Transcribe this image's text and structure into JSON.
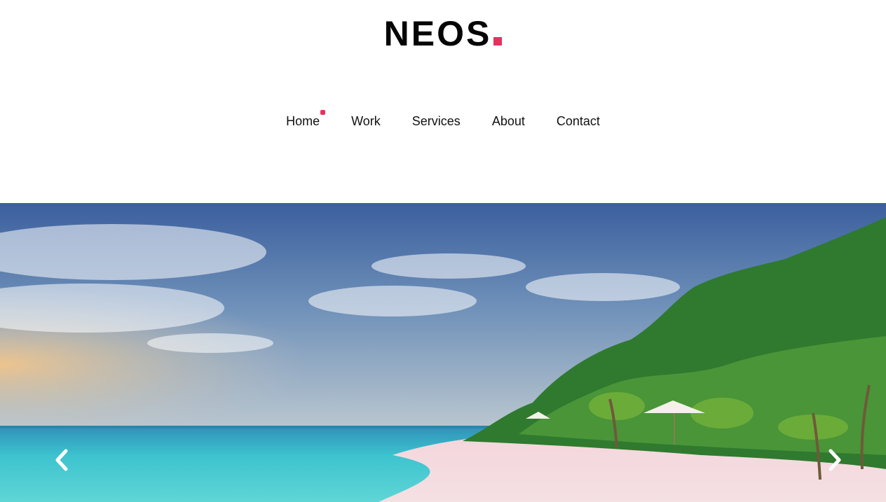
{
  "brand": {
    "name": "NEOS",
    "accent": "#e8305f"
  },
  "nav": {
    "active_index": 0,
    "items": [
      {
        "label": "Home"
      },
      {
        "label": "Work"
      },
      {
        "label": "Services"
      },
      {
        "label": "About"
      },
      {
        "label": "Contact"
      }
    ]
  },
  "slider": {
    "prev_icon": "chevron-left-icon",
    "next_icon": "chevron-right-icon",
    "image": "tropical-beach-with-palm-trees"
  }
}
